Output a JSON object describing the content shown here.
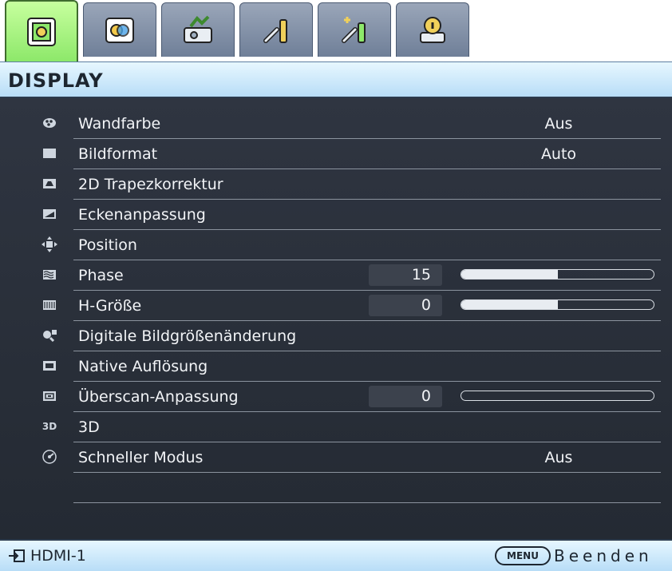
{
  "tabs": [
    {
      "icon": "display-settings-icon",
      "active": true
    },
    {
      "icon": "picture-icon",
      "active": false
    },
    {
      "icon": "basic-setup-icon",
      "active": false
    },
    {
      "icon": "system-setup-basic-icon",
      "active": false
    },
    {
      "icon": "system-setup-advanced-icon",
      "active": false
    },
    {
      "icon": "information-icon",
      "active": false
    }
  ],
  "header": {
    "title": "DISPLAY"
  },
  "menu": {
    "items": [
      {
        "icon": "wall-color-icon",
        "label": "Wandfarbe",
        "value": "Aus"
      },
      {
        "icon": "aspect-ratio-icon",
        "label": "Bildformat",
        "value": "Auto"
      },
      {
        "icon": "keystone-icon",
        "label": "2D Trapezkorrektur"
      },
      {
        "icon": "corner-fit-icon",
        "label": "Eckenanpassung"
      },
      {
        "icon": "position-icon",
        "label": "Position"
      },
      {
        "icon": "phase-icon",
        "label": "Phase",
        "number": "15",
        "level": 0.5
      },
      {
        "icon": "h-size-icon",
        "label": "H-Größe",
        "number": "0",
        "level": 0.5
      },
      {
        "icon": "digital-zoom-icon",
        "label": "Digitale Bildgrößenänderung"
      },
      {
        "icon": "native-resolution-icon",
        "label": "Native Auflösung"
      },
      {
        "icon": "overscan-icon",
        "label": "Überscan-Anpassung",
        "number": "0",
        "level": 0
      },
      {
        "icon": "3d-icon",
        "icon_text": "3D",
        "label": "3D"
      },
      {
        "icon": "fast-mode-icon",
        "label": "Schneller Modus",
        "value": "Aus"
      },
      {
        "icon": null,
        "label": ""
      }
    ]
  },
  "footer": {
    "source_icon": "input-source-icon",
    "source": "HDMI-1",
    "menu_key": "MENU",
    "exit_label": "Beenden"
  }
}
